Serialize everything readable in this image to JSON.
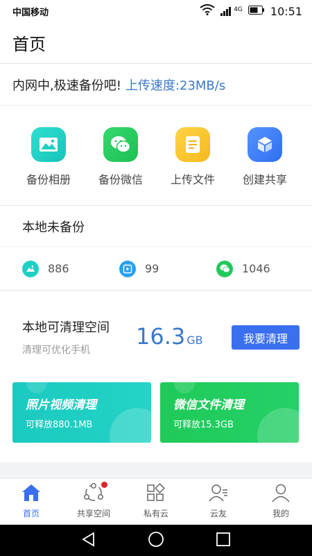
{
  "status_bar": {
    "carrier": "中国移动",
    "network": "4G",
    "time": "10:51"
  },
  "header": {
    "title": "首页"
  },
  "notice": {
    "text": "内网中,极速备份吧!",
    "speed": "上传速度:23MB/s"
  },
  "quick_actions": [
    {
      "label": "备份相册",
      "icon": "photo-album-icon",
      "color": "#1fcfc4"
    },
    {
      "label": "备份微信",
      "icon": "wechat-icon",
      "color": "#22c85a"
    },
    {
      "label": "上传文件",
      "icon": "document-icon",
      "color": "#f6c32a"
    },
    {
      "label": "创建共享",
      "icon": "cube-icon",
      "color": "#3d7ff5"
    }
  ],
  "unbackup": {
    "title": "本地未备份",
    "stats": [
      {
        "icon": "photo-icon",
        "value": "886",
        "color": "#1fcfc4"
      },
      {
        "icon": "video-icon",
        "value": "99",
        "color": "#2b9ff0"
      },
      {
        "icon": "wechat-icon",
        "value": "1046",
        "color": "#22c85a"
      }
    ]
  },
  "cleanup": {
    "label": "本地可清理空间",
    "sub": "清理可优化手机",
    "size": "16.3",
    "unit": "GB",
    "button": "我要清理",
    "cards": [
      {
        "title": "照片视频清理",
        "sub": "可释放880.1MB"
      },
      {
        "title": "微信文件清理",
        "sub": "可释放15.3GB"
      }
    ]
  },
  "tabs": [
    {
      "label": "首页",
      "icon": "home-icon",
      "active": true
    },
    {
      "label": "共享空间",
      "icon": "share-space-icon",
      "badge": true
    },
    {
      "label": "私有云",
      "icon": "private-cloud-icon"
    },
    {
      "label": "云友",
      "icon": "friends-icon"
    },
    {
      "label": "我的",
      "icon": "profile-icon"
    }
  ],
  "colors": {
    "accent": "#3a6ff0",
    "link": "#3a78c9"
  }
}
